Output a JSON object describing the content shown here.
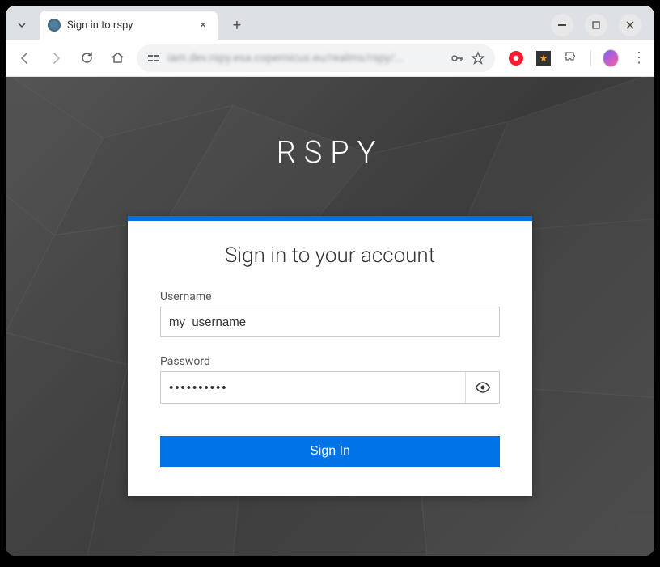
{
  "browser": {
    "tab_title": "Sign in to rspy",
    "url_display": "iam.dev.rspy.esa.copernicus.eu/realms/rspy/..."
  },
  "page": {
    "brand": "RSPY",
    "card_title": "Sign in to your account",
    "username_label": "Username",
    "username_value": "my_username",
    "password_label": "Password",
    "password_value": "••••••••••",
    "signin_label": "Sign In"
  }
}
